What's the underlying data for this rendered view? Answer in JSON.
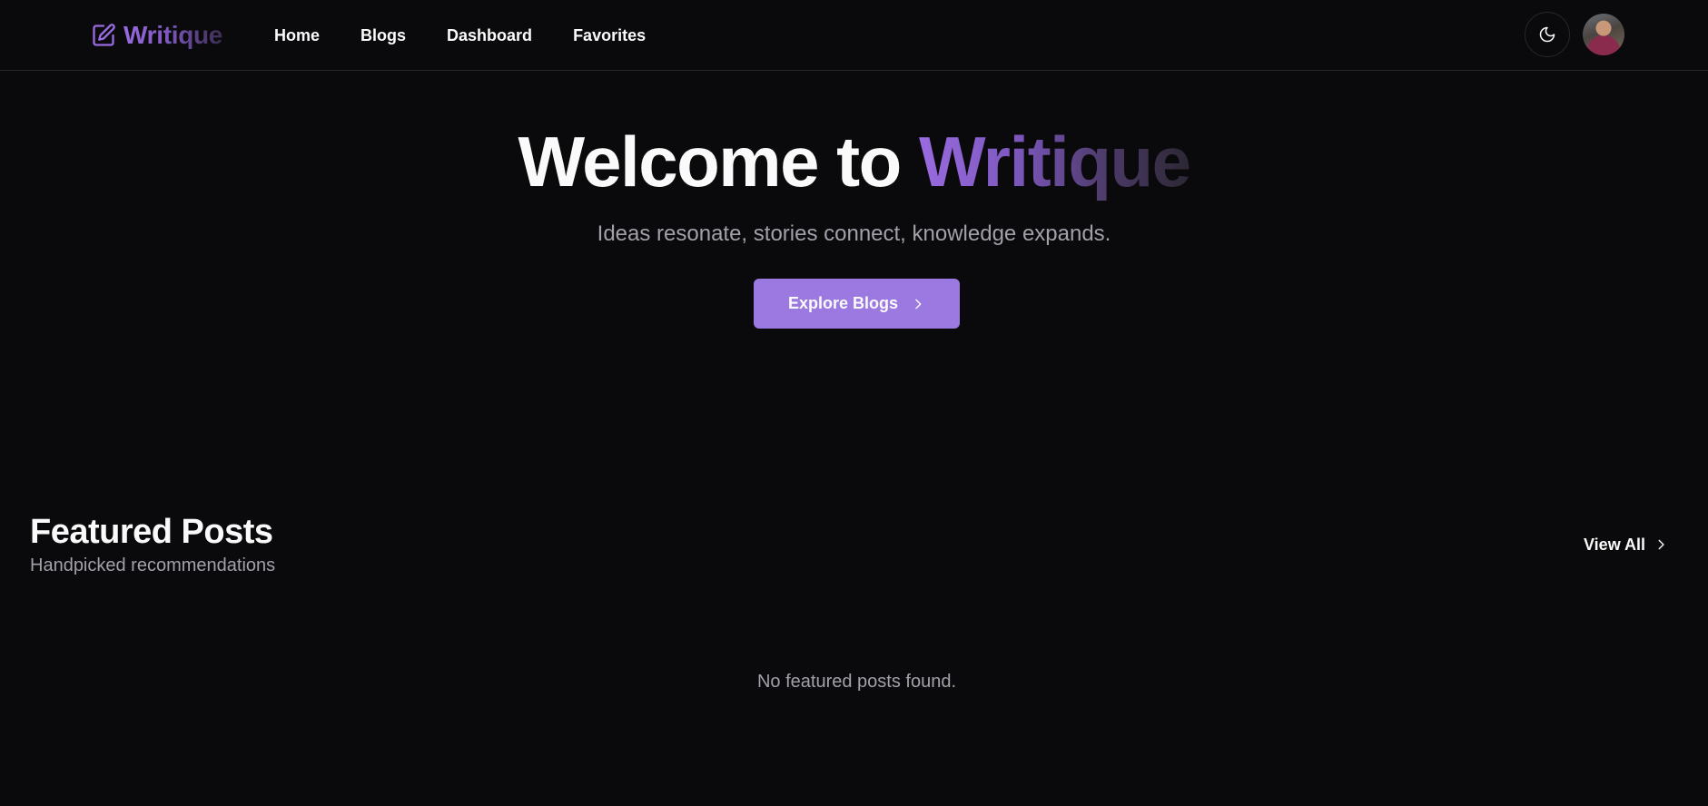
{
  "header": {
    "logo_text": "Writique",
    "logo_icon": "edit-square-icon",
    "nav": [
      {
        "label": "Home"
      },
      {
        "label": "Blogs"
      },
      {
        "label": "Dashboard"
      },
      {
        "label": "Favorites"
      }
    ],
    "theme_toggle_icon": "moon-icon",
    "avatar": "user-avatar"
  },
  "hero": {
    "title_plain": "Welcome to ",
    "title_brand": "Writique",
    "subtitle": "Ideas resonate, stories connect, knowledge expands.",
    "cta_label": "Explore Blogs",
    "cta_icon": "chevron-right-icon"
  },
  "featured": {
    "title": "Featured Posts",
    "subtitle": "Handpicked recommendations",
    "view_all_label": "View All",
    "view_all_icon": "chevron-right-icon",
    "empty_message": "No featured posts found."
  },
  "colors": {
    "background": "#0a0a0c",
    "accent": "#9b79e0",
    "muted_text": "#a1a1aa",
    "border": "#27272a"
  }
}
